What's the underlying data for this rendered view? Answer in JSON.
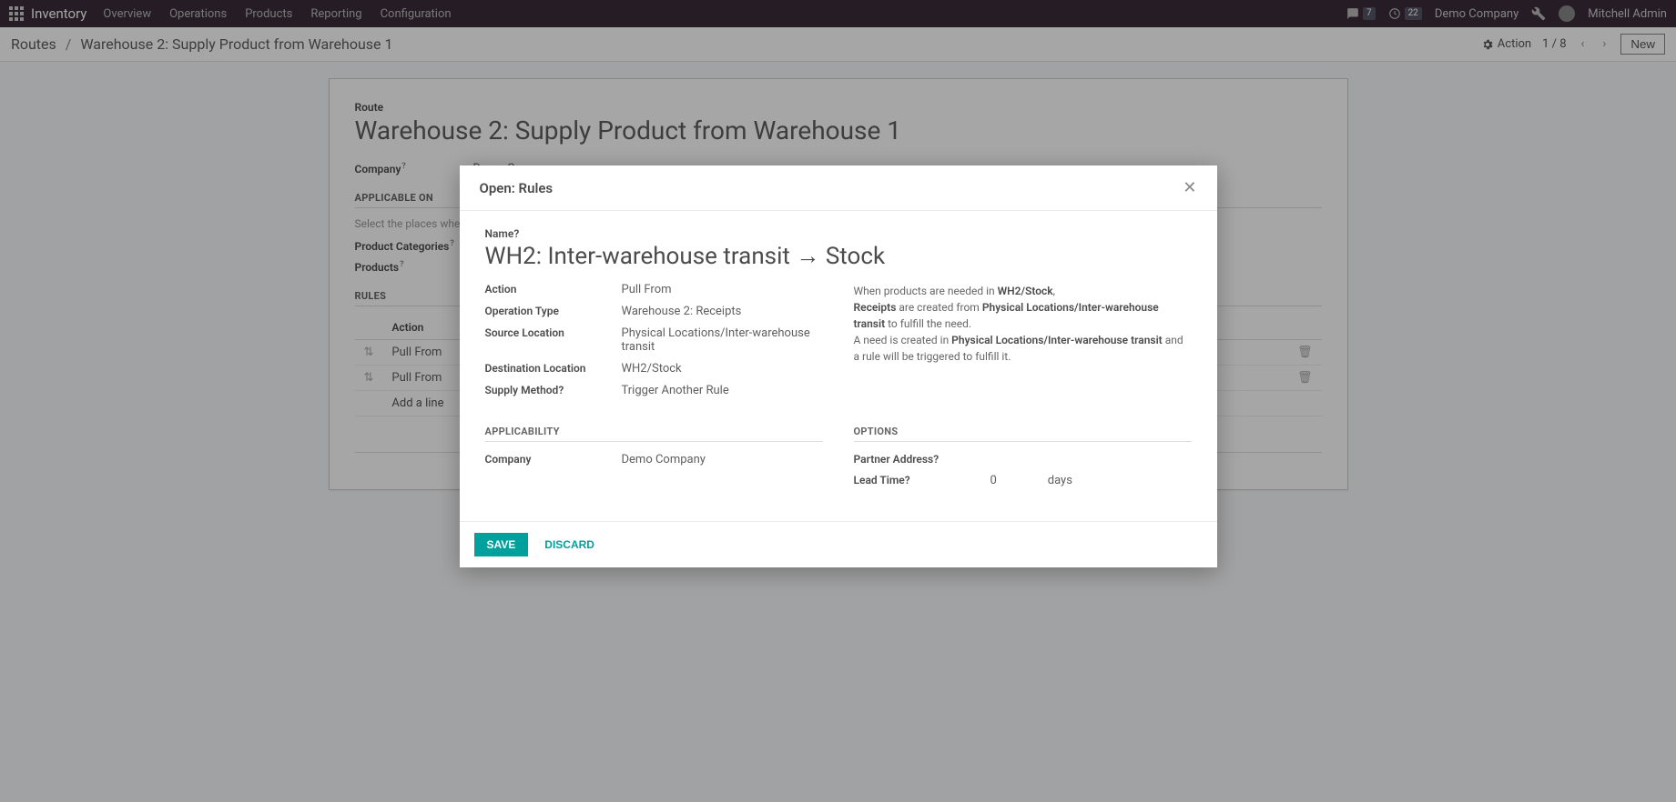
{
  "nav": {
    "brand": "Inventory",
    "items": [
      "Overview",
      "Operations",
      "Products",
      "Reporting",
      "Configuration"
    ],
    "chat_badge": "7",
    "activity_badge": "22",
    "company": "Demo Company",
    "user": "Mitchell Admin"
  },
  "controlbar": {
    "crumb_root": "Routes",
    "crumb_current": "Warehouse 2: Supply Product from Warehouse 1",
    "action_label": "Action",
    "pager": "1 / 8",
    "new_label": "New"
  },
  "route": {
    "label": "Route",
    "name": "Warehouse 2: Supply Product from Warehouse 1",
    "company_label": "Company",
    "company_value": "Demo Company",
    "applicable_head": "APPLICABLE ON",
    "applicable_hint": "Select the places where",
    "prodcat_label": "Product Categories",
    "products_label": "Products",
    "rules_head": "RULES",
    "col_action": "Action",
    "rows": [
      {
        "action": "Pull From"
      },
      {
        "action": "Pull From"
      }
    ],
    "add_line": "Add a line"
  },
  "modal": {
    "title": "Open: Rules",
    "name_label": "Name",
    "name_value": "WH2: Inter-warehouse transit → Stock",
    "action_label": "Action",
    "action_value": "Pull From",
    "optype_label": "Operation Type",
    "optype_value": "Warehouse 2: Receipts",
    "srcloc_label": "Source Location",
    "srcloc_value": "Physical Locations/Inter-warehouse transit",
    "dstloc_label": "Destination Location",
    "dstloc_value": "WH2/Stock",
    "supply_label": "Supply Method",
    "supply_value": "Trigger Another Rule",
    "explain_pre": "When products are needed in ",
    "explain_loc1": "WH2/Stock",
    "explain_mid1": ",",
    "explain_br1a": "Receipts",
    "explain_br1b": " are created from ",
    "explain_loc2": "Physical Locations/Inter-warehouse transit",
    "explain_br1c": " to fulfill the need.",
    "explain_br2a": "A need is created in ",
    "explain_loc3": "Physical Locations/Inter-warehouse transit",
    "explain_br2b": " and a rule will be triggered to fulfill it.",
    "applicability_head": "APPLICABILITY",
    "company_label": "Company",
    "company_value": "Demo Company",
    "options_head": "OPTIONS",
    "partner_label": "Partner Address",
    "leadtime_label": "Lead Time",
    "leadtime_value": "0",
    "leadtime_unit": "days",
    "save": "SAVE",
    "discard": "DISCARD"
  }
}
